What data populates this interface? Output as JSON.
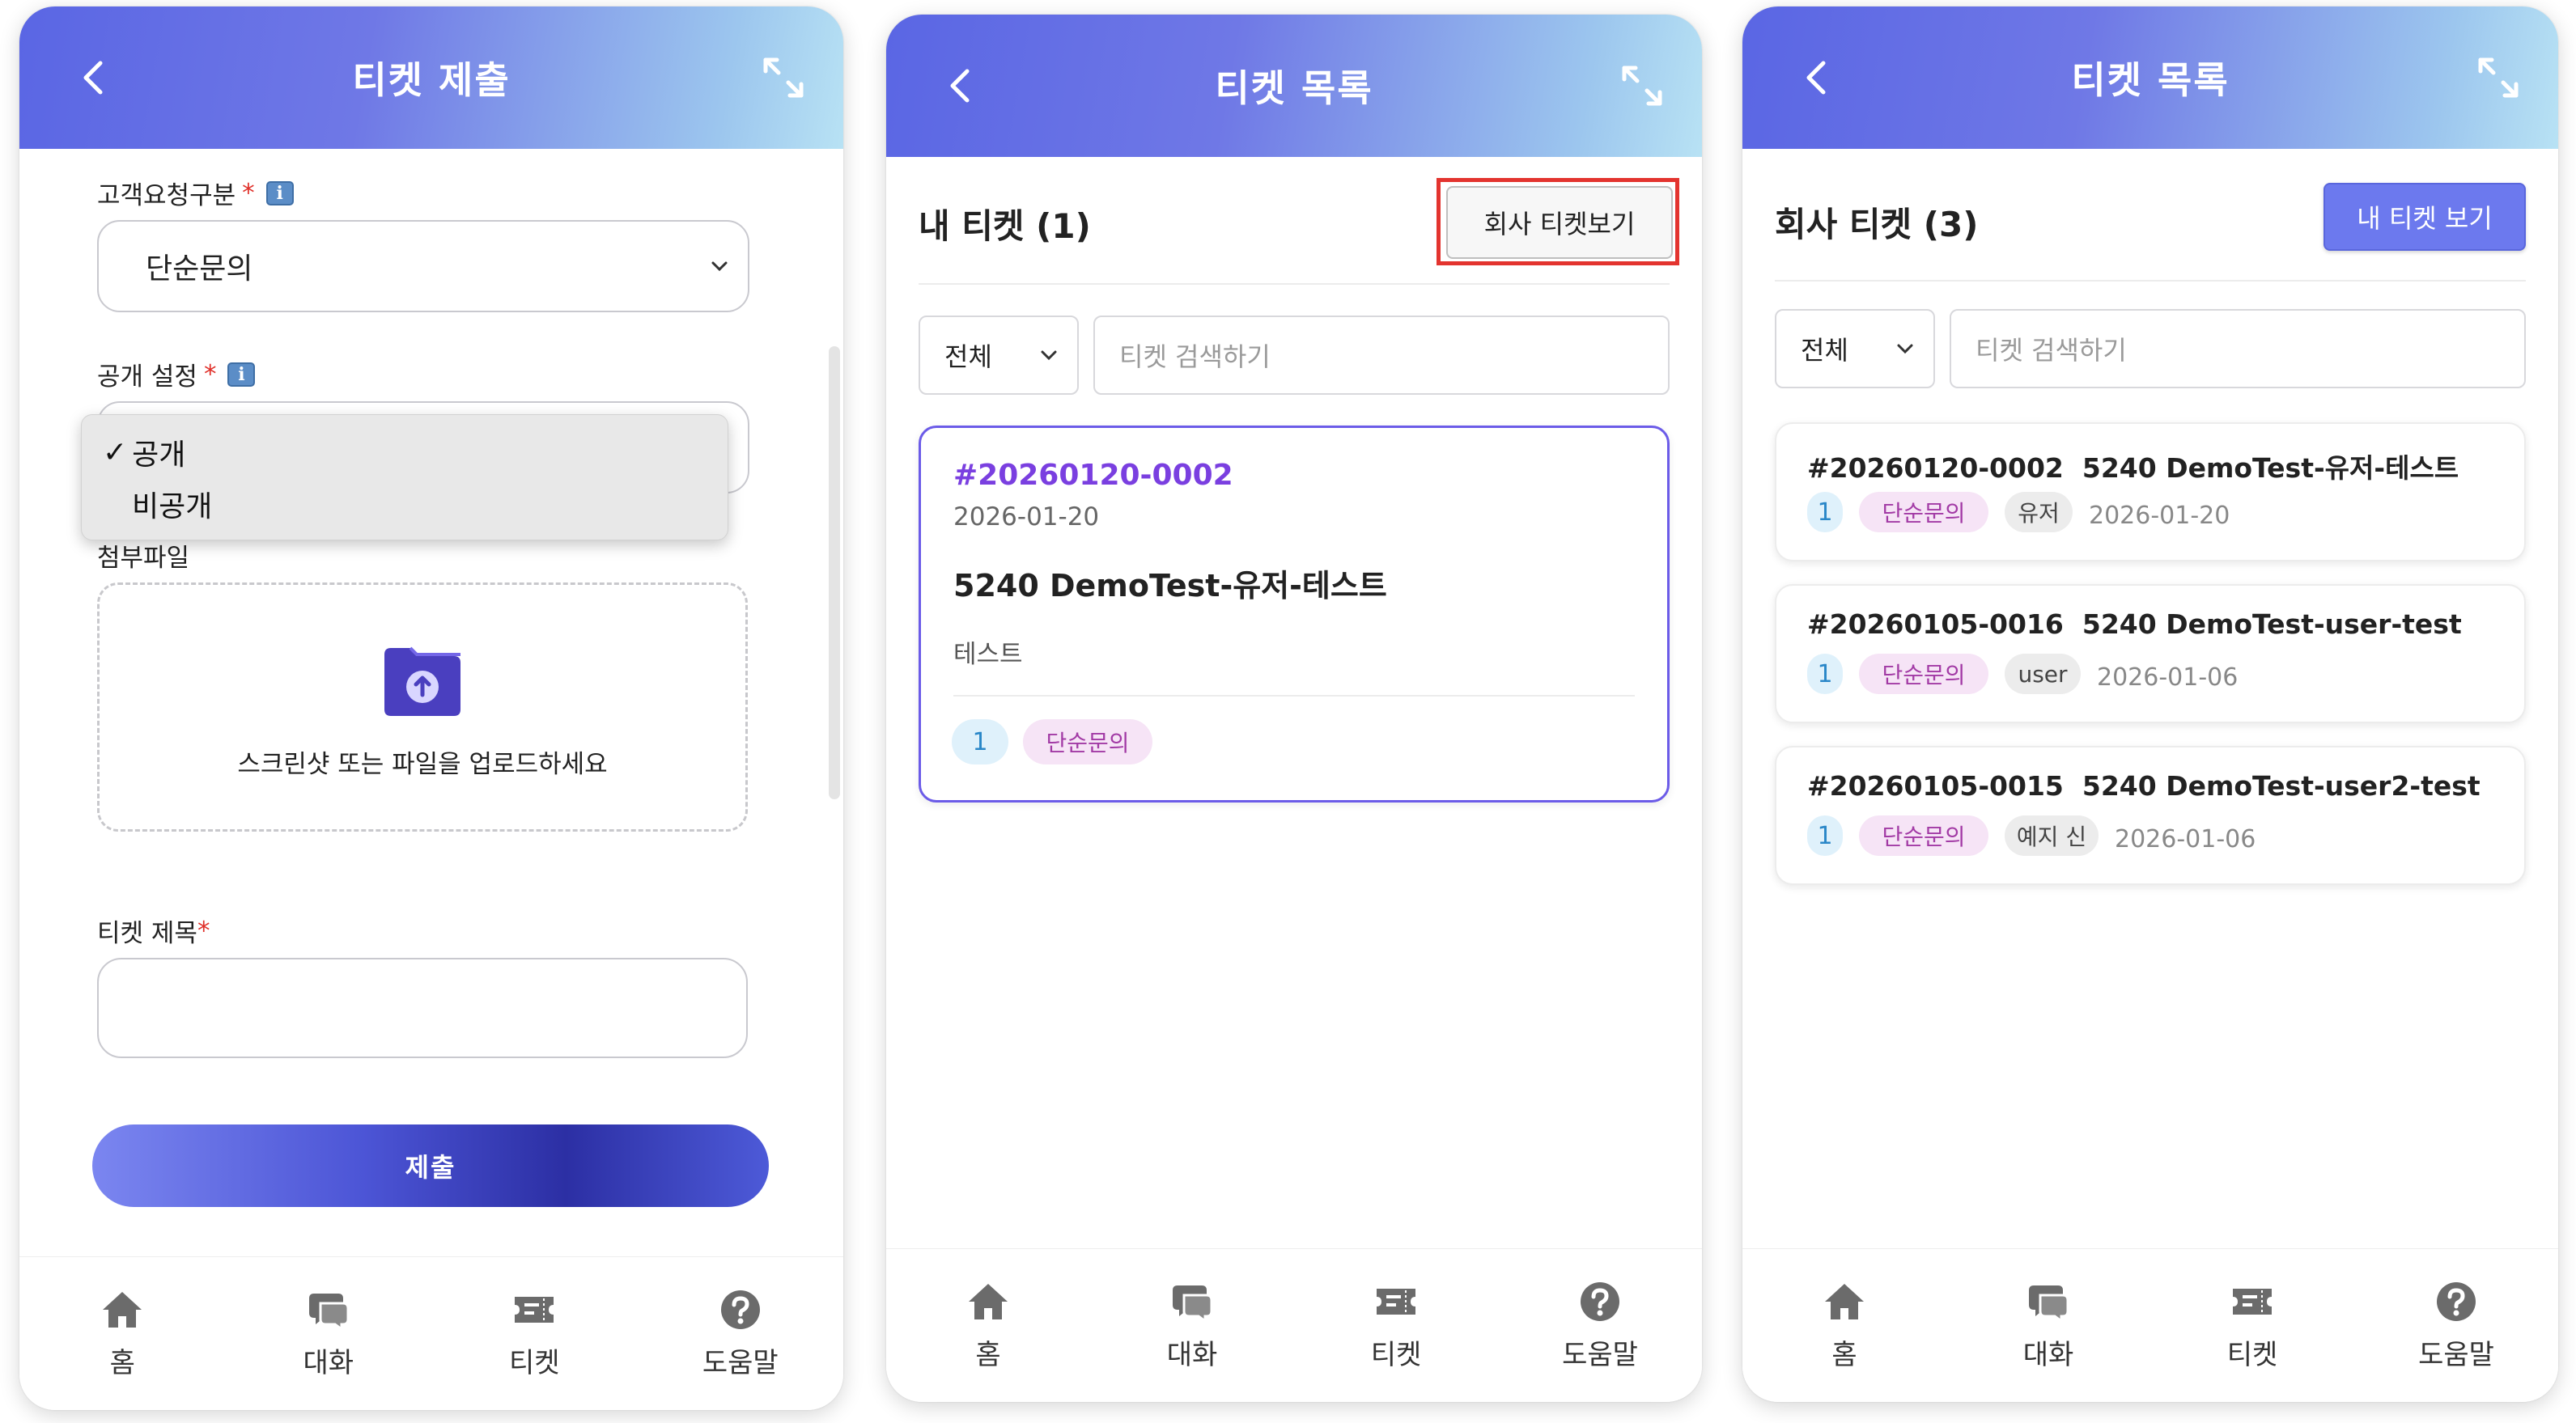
{
  "icons": {
    "back": "chevron-left-icon",
    "expand": "expand-icon",
    "info": "info-icon",
    "upload": "folder-upload-icon",
    "home": "home-icon",
    "chat": "chat-icon",
    "ticket": "ticket-icon",
    "help": "help-icon",
    "check": "checkmark-icon"
  },
  "colors": {
    "header_start": "#5a66e4",
    "header_end": "#b8e2f4",
    "accent_purple": "#7a3fe0",
    "primary_button": "#6c79ee",
    "highlight_red": "#e3342f",
    "required": "#e0302a"
  },
  "nav": {
    "home": "홈",
    "chat": "대화",
    "ticket": "티켓",
    "help": "도움말"
  },
  "submit_screen": {
    "title": "티켓 제출",
    "request_type_label": "고객요청구분",
    "required_mark": "*",
    "request_type_value": "단순문의",
    "visibility_label": "공개 설정",
    "visibility_options": [
      "공개",
      "비공개"
    ],
    "visibility_check": "✓",
    "attachment_label": "첨부파일",
    "upload_text": "스크린샷 또는 파일을 업로드하세요",
    "ticket_title_label": "티켓 제목",
    "submit_label": "제출"
  },
  "my_tickets_screen": {
    "title": "티켓 목록",
    "list_title": "내 티켓 (1)",
    "toggle_button": "회사 티켓보기",
    "filter_value": "전체",
    "search_placeholder": "티켓 검색하기",
    "ticket": {
      "id": "#20260120-0002",
      "date": "2026-01-20",
      "title": "5240 DemoTest-유저-테스트",
      "description": "테스트",
      "count": "1",
      "category": "단순문의"
    }
  },
  "company_tickets_screen": {
    "title": "티켓 목록",
    "list_title": "회사 티켓 (3)",
    "toggle_button": "내 티켓 보기",
    "filter_value": "전체",
    "search_placeholder": "티켓 검색하기",
    "tickets": [
      {
        "id": "#20260120-0002",
        "title": "5240 DemoTest-유저-테스트",
        "count": "1",
        "category": "단순문의",
        "user": "유저",
        "date": "2026-01-20"
      },
      {
        "id": "#20260105-0016",
        "title": "5240 DemoTest-user-test",
        "count": "1",
        "category": "단순문의",
        "user": "user",
        "date": "2026-01-06"
      },
      {
        "id": "#20260105-0015",
        "title": "5240 DemoTest-user2-test",
        "count": "1",
        "category": "단순문의",
        "user": "예지 신",
        "date": "2026-01-06"
      }
    ]
  }
}
